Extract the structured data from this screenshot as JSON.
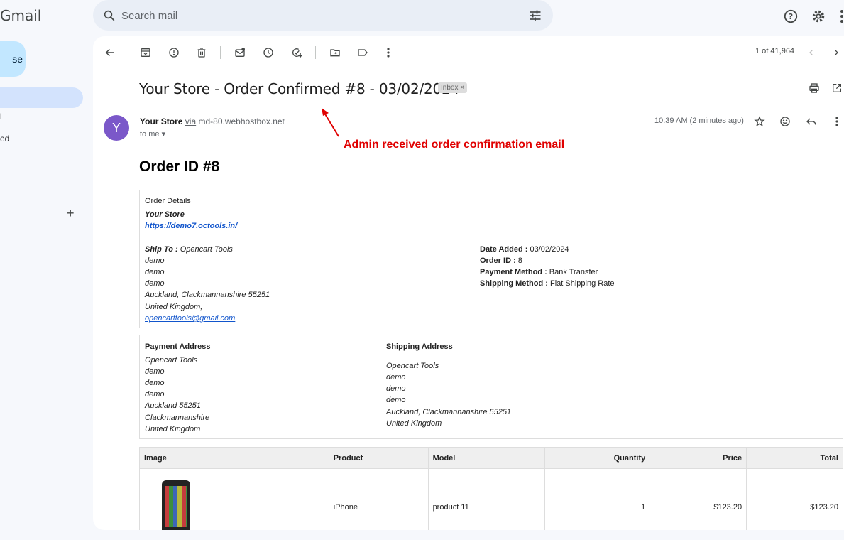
{
  "app": {
    "logo": "Gmail",
    "compose_fragment": "se",
    "nav_fragments": [
      "l",
      "ed"
    ],
    "labels_add": "+"
  },
  "search": {
    "placeholder": "Search mail"
  },
  "pager": {
    "text": "1 of 41,964"
  },
  "email": {
    "subject": "Your Store - Order Confirmed #8 - 03/02/2024",
    "badge": "Inbox",
    "badge_close": "×",
    "avatar_letter": "Y",
    "sender_name": "Your Store",
    "via": "via",
    "sender_domain": "md-80.webhostbox.net",
    "to": "to me",
    "time": "10:39 AM (2 minutes ago)",
    "annotation": "Admin received order confirmation email"
  },
  "order": {
    "heading": "Order ID #8",
    "details_title": "Order Details",
    "store_name": "Your Store",
    "store_url": "https://demo7.octools.in/",
    "ship_to_label": "Ship To :",
    "ship_to_name": "Opencart Tools",
    "ship_lines": [
      "demo",
      "demo",
      "demo",
      "Auckland, Clackmannanshire 55251",
      "United Kingdom,"
    ],
    "email": "opencarttools@gmail.com",
    "date_added_label": "Date Added :",
    "date_added": "03/02/2024",
    "order_id_label": "Order ID :",
    "order_id": "8",
    "payment_method_label": "Payment Method :",
    "payment_method": "Bank Transfer",
    "shipping_method_label": "Shipping Method :",
    "shipping_method": "Flat Shipping Rate",
    "payment_address_title": "Payment Address",
    "payment_address": [
      "Opencart Tools",
      "demo",
      "demo",
      "demo",
      "Auckland 55251",
      "Clackmannanshire",
      "United Kingdom"
    ],
    "shipping_address_title": "Shipping Address",
    "shipping_address": [
      "Opencart Tools",
      "demo",
      "demo",
      "demo",
      "Auckland, Clackmannanshire 55251",
      "United Kingdom"
    ]
  },
  "products": {
    "headers": [
      "Image",
      "Product",
      "Model",
      "Quantity",
      "Price",
      "Total"
    ],
    "rows": [
      {
        "product": "iPhone",
        "model": "product 11",
        "quantity": "1",
        "price": "$123.20",
        "total": "$123.20"
      }
    ]
  },
  "colors": {
    "annotation": "#e00000",
    "compose": "#c2e7ff",
    "avatar": "#7b58c9"
  }
}
